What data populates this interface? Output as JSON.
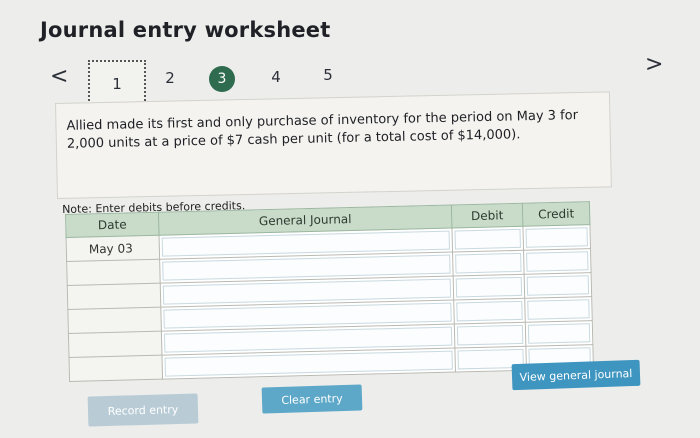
{
  "header": {
    "title": "Journal entry worksheet"
  },
  "nav": {
    "prev_icon": "chevron-left-icon",
    "next_icon": "chevron-right-icon",
    "prev_glyph": "<",
    "next_glyph": ">",
    "steps": [
      "1",
      "2",
      "3",
      "4",
      "5"
    ],
    "active_step": "3"
  },
  "question": {
    "text": "Allied made its first and only purchase of inventory for the period on May 3 for 2,000 units at a price of $7 cash per unit (for a total cost of $14,000)."
  },
  "note": "Note: Enter debits before credits.",
  "journal": {
    "headers": {
      "date": "Date",
      "general_journal": "General Journal",
      "debit": "Debit",
      "credit": "Credit"
    },
    "rows": [
      {
        "date": "May 03"
      },
      {
        "date": ""
      },
      {
        "date": ""
      },
      {
        "date": ""
      },
      {
        "date": ""
      },
      {
        "date": ""
      }
    ]
  },
  "buttons": {
    "record_entry": "Record entry",
    "clear_entry": "Clear entry",
    "view_general_journal": "View general journal"
  },
  "colors": {
    "active_step": "#2e6b4f",
    "table_header": "#c8dcc9",
    "record_button": "#b9ccd6",
    "clear_button": "#5da8c8",
    "view_button": "#3e95c0"
  }
}
